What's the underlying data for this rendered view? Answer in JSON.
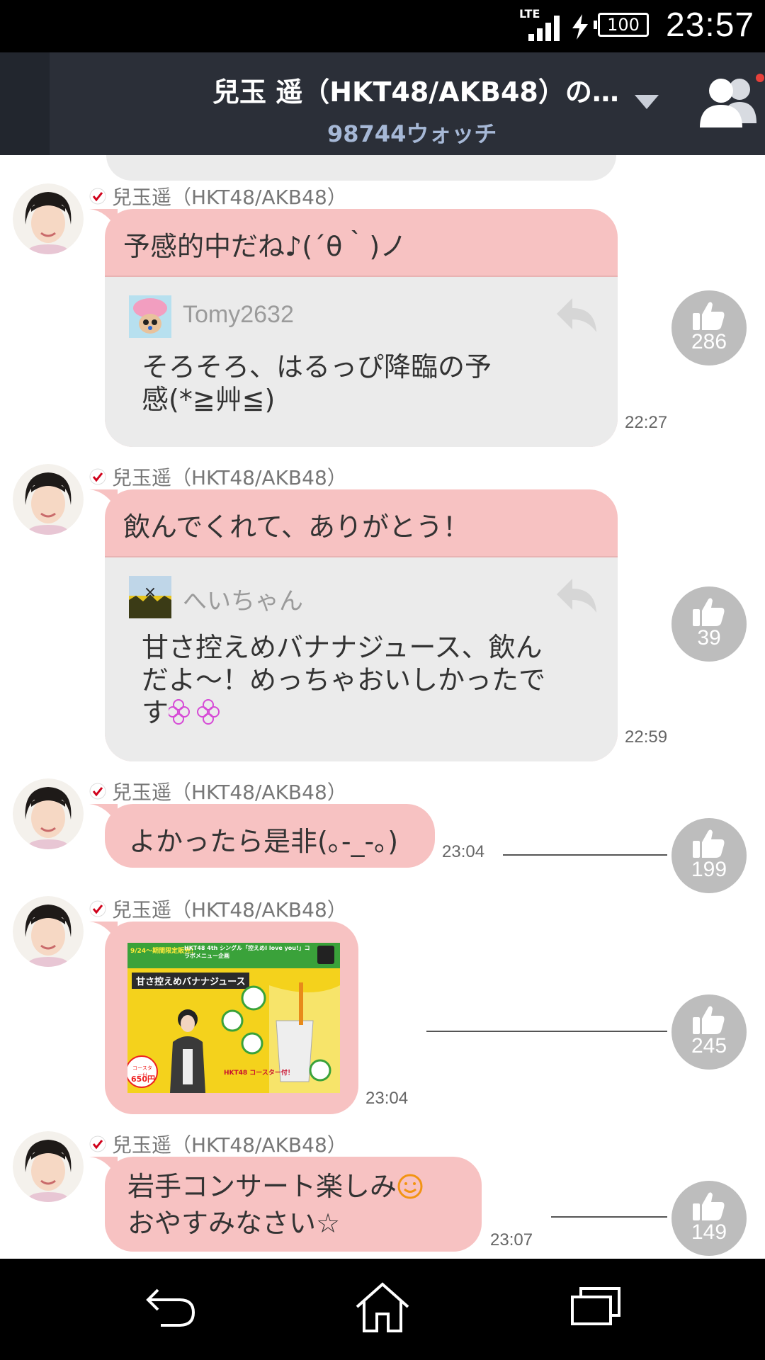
{
  "status_bar": {
    "network": "LTE",
    "battery": "100",
    "time": "23:57"
  },
  "header": {
    "title": "兒玉 遥（HKT48/AKB48）の…",
    "subtitle": "98744ウォッチ",
    "icons": [
      "chevron-down-icon",
      "friends-icon"
    ]
  },
  "messages": [
    {
      "name": "兒玉遥（HKT48/AKB48）",
      "text": "予感的中だね♪(´θ｀)ノ",
      "reply": {
        "user": "Tomy2632",
        "text_lines": [
          "そろそろ、はるっぴ降臨の予",
          "感(*≧艸≦)"
        ]
      },
      "time": "22:27",
      "likes": "286"
    },
    {
      "name": "兒玉遥（HKT48/AKB48）",
      "text": "飲んでくれて、ありがとう！",
      "reply": {
        "user": "へいちゃん",
        "text_lines": [
          "甘さ控えめバナナジュース、飲ん",
          "だよ～！めっちゃおいしかったで",
          "す"
        ]
      },
      "time": "22:59",
      "likes": "39"
    },
    {
      "name": "兒玉遥（HKT48/AKB48）",
      "text": "よかったら是非(｡-_-｡)",
      "time": "23:04",
      "likes": "199"
    },
    {
      "name": "兒玉遥（HKT48/AKB48）",
      "image": {
        "banner": "9/24～期間限定販売！",
        "heading": "HKT48 4th シングル「控えめI love you!」コラボメニュー企画",
        "product": "甘さ控えめバナナジュース",
        "coaster": "HKT48 コースター付！",
        "price_label": "コースター付",
        "price": "650円"
      },
      "time": "23:04",
      "likes": "245"
    },
    {
      "name": "兒玉遥（HKT48/AKB48）",
      "text_lines": [
        "岩手コンサート楽しみ",
        "おやすみなさい☆"
      ],
      "time": "23:07",
      "likes": "149"
    }
  ],
  "colors": {
    "header_bg": "#2b2f38",
    "bubble_pink": "#f7c2c2",
    "reply_gray": "#ebebeb",
    "like_gray": "#bdbdbd",
    "subtitle_blue": "#a6b8d6"
  }
}
